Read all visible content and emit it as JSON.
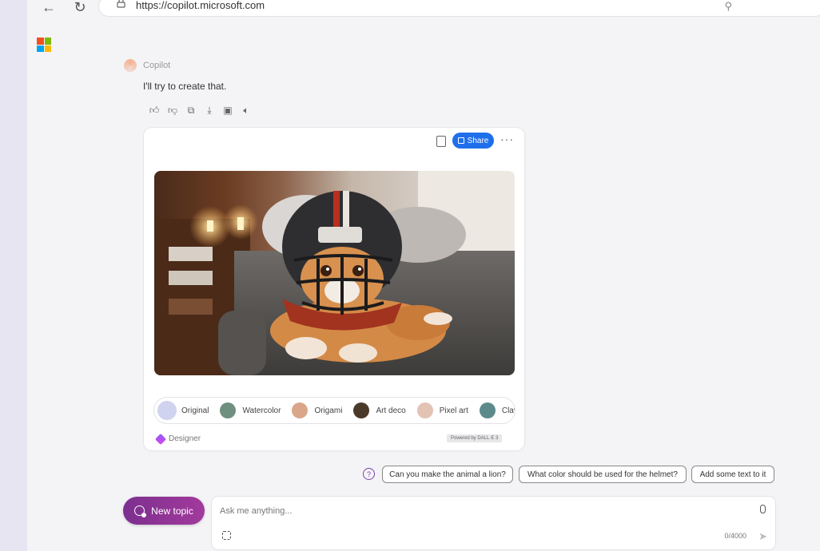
{
  "browser": {
    "back_icon": "arrow-left-icon",
    "reload_icon": "reload-icon",
    "url": "https://copilot.microsoft.com"
  },
  "chat": {
    "sender": "Copilot",
    "reply": "I'll try to create that.",
    "actions": [
      "thumbs-up-icon",
      "thumbs-down-icon",
      "copy-icon",
      "download-icon",
      "export-icon",
      "read-aloud-icon"
    ]
  },
  "card": {
    "share_label": "Share",
    "more_label": "···",
    "styles": [
      {
        "label": "Original",
        "color": "#cfd3ef"
      },
      {
        "label": "Watercolor",
        "color": "#6f8f7f"
      },
      {
        "label": "Origami",
        "color": "#d9a68a"
      },
      {
        "label": "Art deco",
        "color": "#4b3a2a"
      },
      {
        "label": "Pixel art",
        "color": "#e3c3b4"
      },
      {
        "label": "Claymation",
        "color": "#5c8a8a"
      }
    ],
    "designer_label": "Designer",
    "powered_label": "Powered by DALL·E 3"
  },
  "suggestions": [
    "Can you make the animal a lion?",
    "What color should be used for the helmet?",
    "Add some text to it"
  ],
  "composer": {
    "new_topic_label": "New topic",
    "placeholder": "Ask me anything...",
    "char_count": "0/4000"
  },
  "colors": {
    "accent": "#1f6feb",
    "new_topic": "#8a338f"
  }
}
